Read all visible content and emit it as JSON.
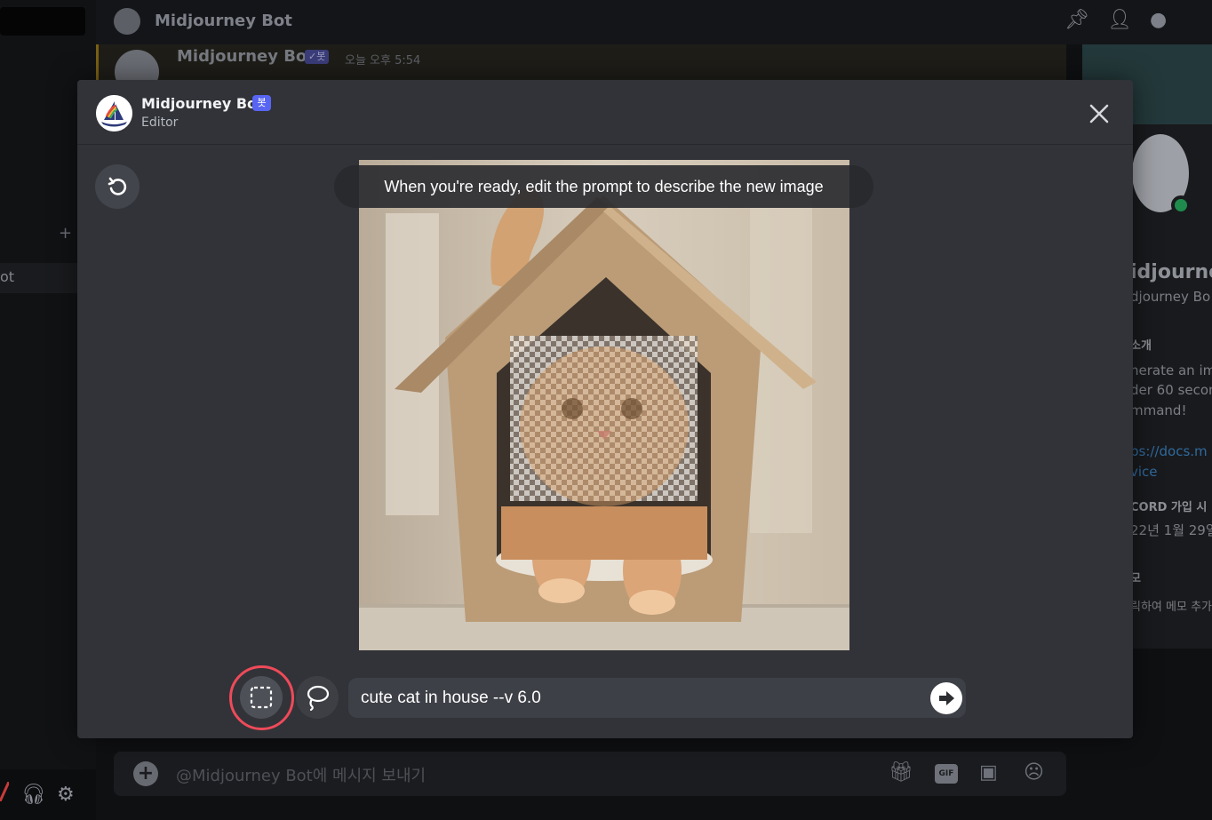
{
  "background": {
    "left_sidebar": {
      "item_label": "ot",
      "add_icon": "plus-icon"
    },
    "channel_header": {
      "title": "Midjourney Bot"
    },
    "message": {
      "author": "Midjourney Bot",
      "badge": "✓봇",
      "timestamp": "오늘 오후 5:54"
    },
    "profile_panel": {
      "display_name": "idjourne",
      "username": "djourney Bo",
      "about_header": "소개",
      "about_lines": [
        "nerate an im",
        "der 60 secon",
        "mmand!"
      ],
      "link_lines": [
        "ps://docs.m",
        "vice"
      ],
      "joined_header": "CORD 가입 시",
      "joined_date": "22년 1월 29일",
      "note_header": "모",
      "note_placeholder": "릭하여 메모 추가"
    },
    "composer": {
      "placeholder": "@Midjourney Bot에 메시지 보내기",
      "gif_label": "GIF"
    }
  },
  "modal": {
    "header": {
      "bot_name": "Midjourney Bot",
      "bot_badge": "봇",
      "subtitle": "Editor"
    },
    "hint": "When you're ready, edit the prompt to describe the new image",
    "prompt": {
      "value": "cute cat in house --v 6.0"
    },
    "tools": {
      "selected": "rectangle-select"
    }
  },
  "colors": {
    "modal_bg": "#313338",
    "accent_blurple": "#5865f2",
    "selection_ring": "#ef4a59"
  }
}
